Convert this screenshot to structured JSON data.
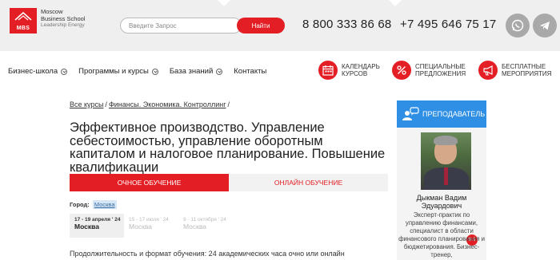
{
  "header": {
    "logo_mark": "MBS",
    "logo_lines": [
      "Moscow",
      "Business School"
    ],
    "logo_tagline": "Leadership Energy",
    "search": {
      "placeholder": "Введите Запрос",
      "button_label": "Найти"
    },
    "phones": [
      "8 800 333 86 68",
      "+7 495 646 75 17"
    ],
    "icons": [
      "whatsapp-icon",
      "telegram-icon"
    ]
  },
  "nav": {
    "items": [
      {
        "label": "Бизнес-школа",
        "has_dropdown": true
      },
      {
        "label": "Программы и курсы",
        "has_dropdown": true
      },
      {
        "label": "База знаний",
        "has_dropdown": true
      },
      {
        "label": "Контакты",
        "has_dropdown": false
      }
    ],
    "promos": [
      {
        "line1": "КАЛЕНДАРЬ",
        "line2": "КУРСОВ",
        "icon": "calendar-icon"
      },
      {
        "line1": "СПЕЦИАЛЬНЫЕ",
        "line2": "ПРЕДЛОЖЕНИЯ",
        "icon": "percent-icon"
      },
      {
        "line1": "БЕСПЛАТНЫЕ",
        "line2": "МЕРОПРИЯТИЯ",
        "icon": "megaphone-icon"
      }
    ]
  },
  "breadcrumb": {
    "items": [
      "Все курсы",
      "Финансы. Экономика. Контроллинг"
    ]
  },
  "course": {
    "title": "Эффективное производство. Управление себестоимостью, управление оборотным капиталом и налоговое планирование. Повышение квалификации",
    "tabs": [
      {
        "label": "ОЧНОЕ ОБУЧЕНИЕ",
        "active": true
      },
      {
        "label": "ОНЛАЙН ОБУЧЕНИЕ",
        "active": false
      }
    ],
    "city_label": "Город:",
    "city_value": "Москва",
    "dates": [
      {
        "range": "17 - 19 апреля ' 24",
        "place": "Москва",
        "active": true
      },
      {
        "range": "15 - 17 июля ' 24",
        "place": "Москва",
        "active": false
      },
      {
        "range": "9 - 11 октября ' 24",
        "place": "Москва",
        "active": false
      }
    ],
    "format_text": "Продолжительность и формат обучения: 24 академических часа очно или онлайн"
  },
  "teacher": {
    "header_label": "ПРЕПОДАВАТЕЛЬ",
    "rating": "9.5",
    "name": "Дыкман Вадим Эдуардович",
    "description": "Эксперт-практик по управлению финансами, специалист в области финансового планирования и бюджетирования. Бизнес-тренер,"
  },
  "colors": {
    "brand_red": "#e31e24",
    "teacher_blue": "#2f8fe5",
    "topbar_gray": "#efefef"
  }
}
